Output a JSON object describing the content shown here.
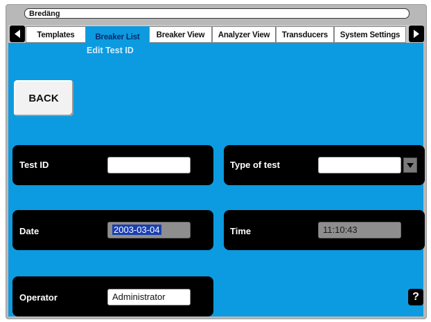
{
  "window": {
    "title": "Bredäng"
  },
  "tabs": [
    {
      "label": "Templates"
    },
    {
      "label": "Breaker List"
    },
    {
      "label": "Breaker View"
    },
    {
      "label": "Analyzer View"
    },
    {
      "label": "Transducers"
    },
    {
      "label": "System Settings"
    }
  ],
  "active_tab": "Breaker List",
  "subtitle": "Edit Test ID",
  "back_label": "BACK",
  "fields": {
    "test_id": {
      "label": "Test ID",
      "value": ""
    },
    "type_of_test": {
      "label": "Type of test",
      "value": ""
    },
    "date": {
      "label": "Date",
      "value": "2003-03-04"
    },
    "time": {
      "label": "Time",
      "value": "11:10:43"
    },
    "operator": {
      "label": "Operator",
      "value": "Administrator"
    }
  },
  "help_label": "?",
  "colors": {
    "background": "#0c9be0",
    "panel": "#000000"
  },
  "icons": {
    "prev": "arrow-left-icon",
    "next": "arrow-right-icon",
    "dropdown": "chevron-down-icon"
  }
}
